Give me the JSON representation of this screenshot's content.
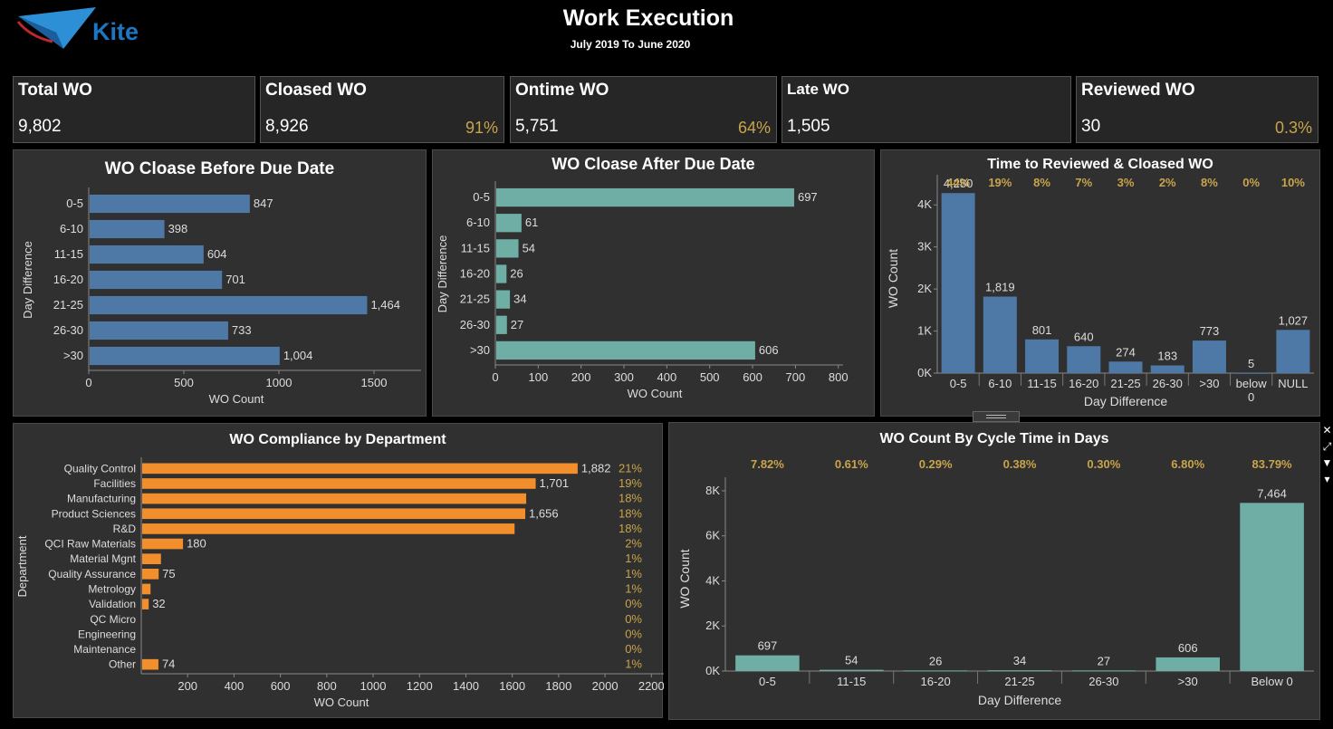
{
  "header": {
    "logo_text": "Kite",
    "title": "Work Execution",
    "subtitle": "July 2019 To June 2020"
  },
  "kpis": [
    {
      "label": "Total WO",
      "value": "9,802",
      "pct": ""
    },
    {
      "label": "Cloased WO",
      "value": "8,926",
      "pct": "91%"
    },
    {
      "label": "Ontime WO",
      "value": "5,751",
      "pct": "64%"
    },
    {
      "label": "Late WO",
      "value": "1,505",
      "pct": ""
    },
    {
      "label": "Reviewed WO",
      "value": "30",
      "pct": "0.3%"
    }
  ],
  "colors": {
    "blue": "#4e79a7",
    "teal": "#6eaea4",
    "orange": "#f28e2b",
    "gold": "#c9a44b",
    "panel": "#303030"
  },
  "chart_data": [
    {
      "id": "before",
      "type": "bar",
      "orientation": "horizontal",
      "title": "WO Cloase Before Due Date",
      "xlabel": "WO Count",
      "ylabel": "Day Difference",
      "categories": [
        "0-5",
        "6-10",
        "11-15",
        "16-20",
        "21-25",
        "26-30",
        ">30"
      ],
      "values": [
        847,
        398,
        604,
        701,
        1464,
        733,
        1004
      ],
      "value_labels": [
        "847",
        "398",
        "604",
        "701",
        "1,464",
        "733",
        "1,004"
      ],
      "xlim": [
        0,
        1700
      ],
      "xticks": [
        0,
        500,
        1000,
        1500
      ],
      "xtick_labels": [
        "0",
        "500",
        "1000",
        "1500"
      ],
      "color": "#4e79a7"
    },
    {
      "id": "after",
      "type": "bar",
      "orientation": "horizontal",
      "title": "WO Cloase After Due Date",
      "xlabel": "WO Count",
      "ylabel": "Day Difference",
      "categories": [
        "0-5",
        "6-10",
        "11-15",
        "16-20",
        "21-25",
        "26-30",
        ">30"
      ],
      "values": [
        697,
        61,
        54,
        26,
        34,
        27,
        606
      ],
      "value_labels": [
        "697",
        "61",
        "54",
        "26",
        "34",
        "27",
        "606"
      ],
      "xlim": [
        0,
        790
      ],
      "xticks": [
        0,
        100,
        200,
        300,
        400,
        500,
        600,
        700,
        800
      ],
      "xtick_labels": [
        "0",
        "100",
        "200",
        "300",
        "400",
        "500",
        "600",
        "700",
        "800"
      ],
      "color": "#6eaea4"
    },
    {
      "id": "reviewed",
      "type": "bar",
      "orientation": "vertical",
      "title": "Time to Reviewed & Cloased WO",
      "xlabel": "Day Difference",
      "ylabel": "WO Count",
      "categories": [
        "0-5",
        "6-10",
        "11-15",
        "16-20",
        "21-25",
        "26-30",
        ">30",
        "below 0",
        "NULL"
      ],
      "values": [
        4280,
        1819,
        801,
        640,
        274,
        183,
        773,
        5,
        1027
      ],
      "value_labels": [
        "4,280",
        "1,819",
        "801",
        "640",
        "274",
        "183",
        "773",
        "5",
        "1,027"
      ],
      "percent_labels": [
        "44%",
        "19%",
        "8%",
        "7%",
        "3%",
        "2%",
        "8%",
        "0%",
        "10%"
      ],
      "ylim": [
        0,
        4500
      ],
      "yticks": [
        0,
        1000,
        2000,
        3000,
        4000
      ],
      "ytick_labels": [
        "0K",
        "1K",
        "2K",
        "3K",
        "4K"
      ],
      "color": "#4e79a7"
    },
    {
      "id": "department",
      "type": "bar",
      "orientation": "horizontal",
      "title": "WO Compliance by Department",
      "xlabel": "WO Count",
      "ylabel": "Department",
      "categories": [
        "Quality Control",
        "Facilities",
        "Manufacturing",
        "Product Sciences",
        "R&D",
        "QCI Raw Materials",
        "Material Mgnt",
        "Quality Assurance",
        "Metrology",
        "Validation",
        "QC Micro",
        "Engineering",
        "Maintenance",
        "Other"
      ],
      "values": [
        1882,
        1701,
        1660,
        1656,
        1610,
        180,
        85,
        75,
        40,
        32,
        0,
        0,
        0,
        74
      ],
      "value_labels": [
        "1,882",
        "1,701",
        "",
        "1,656",
        "",
        "180",
        "",
        "75",
        "",
        "32",
        "",
        "",
        "",
        "74"
      ],
      "percent_labels": [
        "21%",
        "19%",
        "18%",
        "18%",
        "18%",
        "2%",
        "1%",
        "1%",
        "1%",
        "0%",
        "0%",
        "0%",
        "0%",
        "1%"
      ],
      "xlim": [
        0,
        2230
      ],
      "xticks": [
        200,
        400,
        600,
        800,
        1000,
        1200,
        1400,
        1600,
        1800,
        2000,
        2200
      ],
      "xtick_labels": [
        "200",
        "400",
        "600",
        "800",
        "1000",
        "1200",
        "1400",
        "1600",
        "1800",
        "2000",
        "2200"
      ],
      "color": "#f28e2b"
    },
    {
      "id": "cycle",
      "type": "bar",
      "orientation": "vertical",
      "title": "WO Count By Cycle Time in Days",
      "xlabel": "Day Difference",
      "ylabel": "WO Count",
      "categories": [
        "0-5",
        "11-15",
        "16-20",
        "21-25",
        "26-30",
        ">30",
        "Below 0"
      ],
      "values": [
        697,
        54,
        26,
        34,
        27,
        606,
        7464
      ],
      "value_labels": [
        "697",
        "54",
        "26",
        "34",
        "27",
        "606",
        "7,464"
      ],
      "percent_labels": [
        "7.82%",
        "0.61%",
        "0.29%",
        "0.38%",
        "0.30%",
        "6.80%",
        "83.79%"
      ],
      "ylim": [
        0,
        8200
      ],
      "yticks": [
        0,
        2000,
        4000,
        6000,
        8000
      ],
      "ytick_labels": [
        "0K",
        "2K",
        "4K",
        "6K",
        "8K"
      ],
      "color": "#6eaea4"
    }
  ]
}
